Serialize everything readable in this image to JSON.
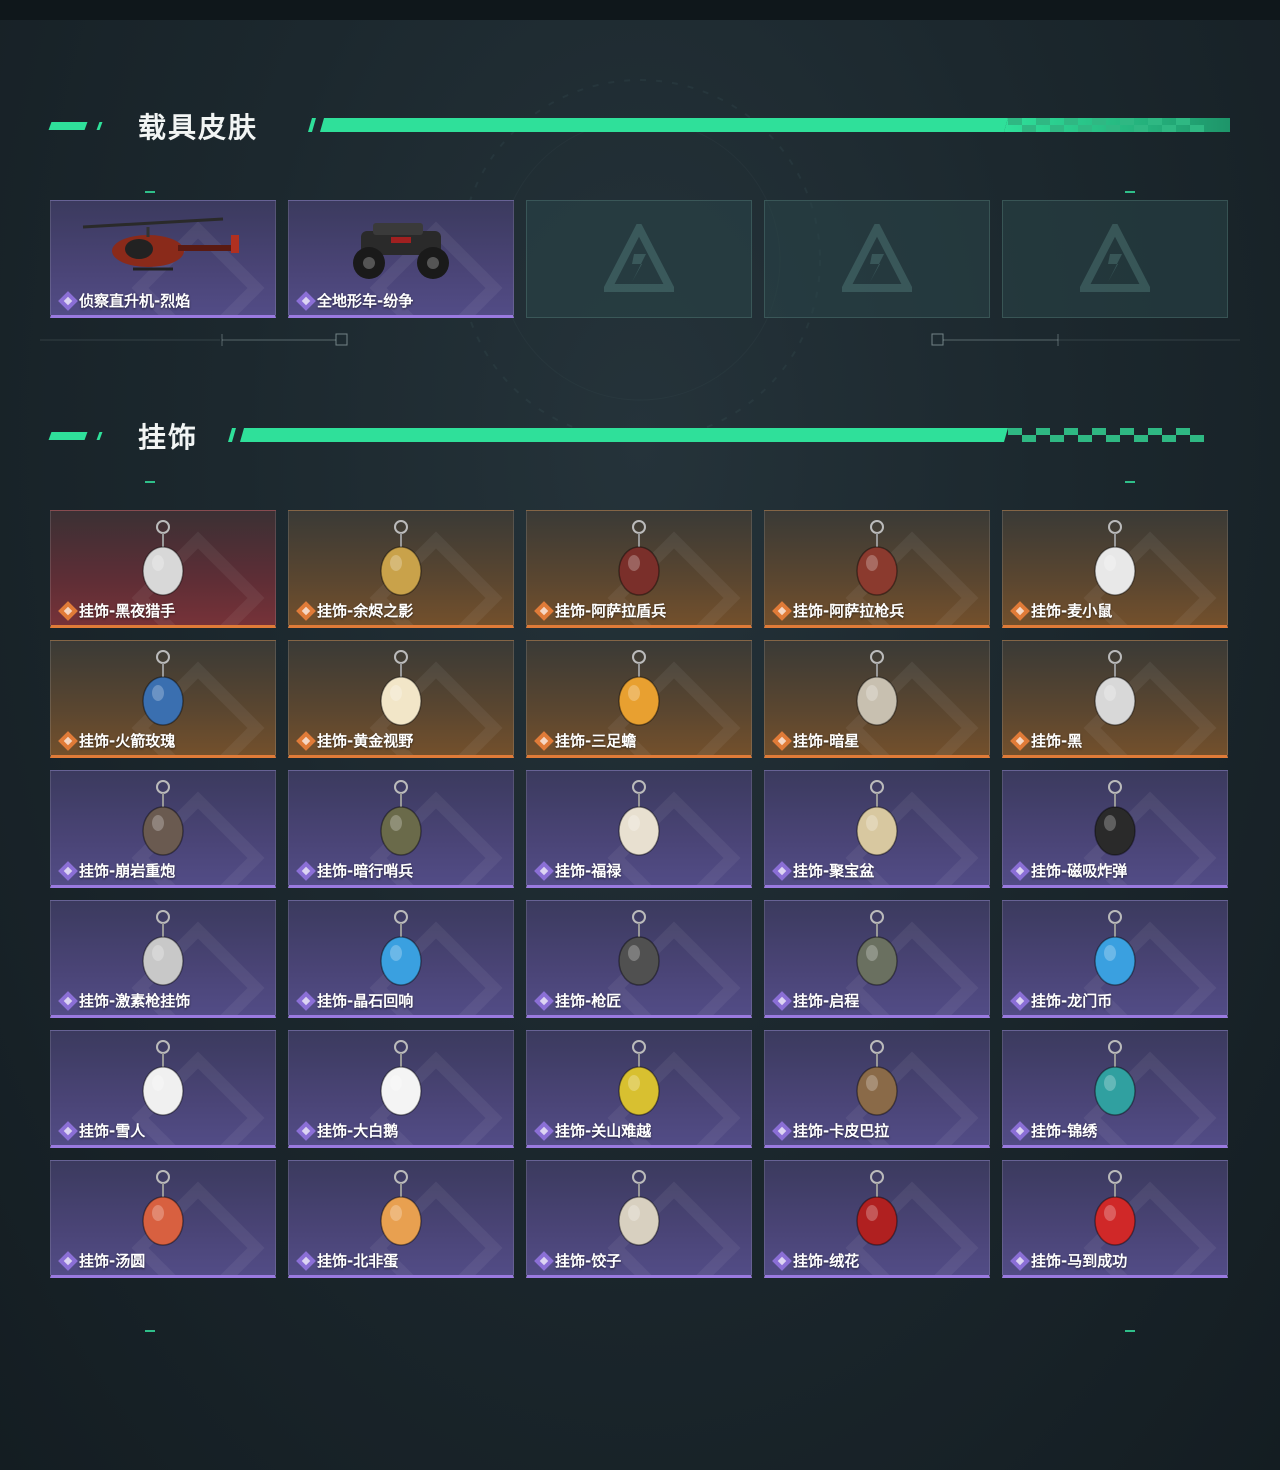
{
  "sections": {
    "vehicle": {
      "title": "载具皮肤"
    },
    "charms": {
      "title": "挂饰"
    }
  },
  "colors": {
    "accent": "#2fe09a",
    "purple_rarity": "#8b6fd6",
    "orange_rarity": "#e07b38"
  },
  "vehicles": [
    {
      "label": "侦察直升机-烈焰",
      "rarity": "purple",
      "icon": "helicopter-icon"
    },
    {
      "label": "全地形车-纷争",
      "rarity": "purple",
      "icon": "atv-icon"
    },
    {
      "label": "",
      "rarity": "empty",
      "icon": "placeholder-logo-icon"
    },
    {
      "label": "",
      "rarity": "empty",
      "icon": "placeholder-logo-icon"
    },
    {
      "label": "",
      "rarity": "empty",
      "icon": "placeholder-logo-icon"
    }
  ],
  "charms": [
    {
      "label": "挂饰-黑夜猎手",
      "rarity": "red"
    },
    {
      "label": "挂饰-余烬之影",
      "rarity": "orange"
    },
    {
      "label": "挂饰-阿萨拉盾兵",
      "rarity": "orange"
    },
    {
      "label": "挂饰-阿萨拉枪兵",
      "rarity": "orange"
    },
    {
      "label": "挂饰-麦小鼠",
      "rarity": "orange"
    },
    {
      "label": "挂饰-火箭玫瑰",
      "rarity": "orange"
    },
    {
      "label": "挂饰-黄金视野",
      "rarity": "orange"
    },
    {
      "label": "挂饰-三足蟾",
      "rarity": "orange"
    },
    {
      "label": "挂饰-暗星",
      "rarity": "orange"
    },
    {
      "label": "挂饰-黑",
      "rarity": "orange"
    },
    {
      "label": "挂饰-崩岩重炮",
      "rarity": "purple"
    },
    {
      "label": "挂饰-暗行哨兵",
      "rarity": "purple"
    },
    {
      "label": "挂饰-福禄",
      "rarity": "purple"
    },
    {
      "label": "挂饰-聚宝盆",
      "rarity": "purple"
    },
    {
      "label": "挂饰-磁吸炸弹",
      "rarity": "purple"
    },
    {
      "label": "挂饰-激素枪挂饰",
      "rarity": "purple"
    },
    {
      "label": "挂饰-晶石回响",
      "rarity": "purple"
    },
    {
      "label": "挂饰-枪匠",
      "rarity": "purple"
    },
    {
      "label": "挂饰-启程",
      "rarity": "purple"
    },
    {
      "label": "挂饰-龙门币",
      "rarity": "purple"
    },
    {
      "label": "挂饰-雪人",
      "rarity": "purple"
    },
    {
      "label": "挂饰-大白鹅",
      "rarity": "purple"
    },
    {
      "label": "挂饰-关山难越",
      "rarity": "purple"
    },
    {
      "label": "挂饰-卡皮巴拉",
      "rarity": "purple"
    },
    {
      "label": "挂饰-锦绣",
      "rarity": "purple"
    },
    {
      "label": "挂饰-汤圆",
      "rarity": "purple"
    },
    {
      "label": "挂饰-北非蛋",
      "rarity": "purple"
    },
    {
      "label": "挂饰-饺子",
      "rarity": "purple"
    },
    {
      "label": "挂饰-绒花",
      "rarity": "purple"
    },
    {
      "label": "挂饰-马到成功",
      "rarity": "purple"
    }
  ],
  "charm_colors": [
    "#d8d8d8",
    "#c9a24a",
    "#7a2f2a",
    "#8b3a2e",
    "#e8e8e8",
    "#3a6fb0",
    "#f2e6c8",
    "#e8a030",
    "#c8c0b0",
    "#d8d8d8",
    "#6a5a50",
    "#6a6a4a",
    "#e8e0d0",
    "#d8c8a0",
    "#2a2a2a",
    "#c8c8c8",
    "#3aa0e0",
    "#505050",
    "#6a7060",
    "#3aa0e0",
    "#f0f0f0",
    "#f4f4f4",
    "#d8c030",
    "#8a6a48",
    "#30a0a0",
    "#d86040",
    "#e8a050",
    "#d8d0c0",
    "#b02020",
    "#d02828"
  ]
}
